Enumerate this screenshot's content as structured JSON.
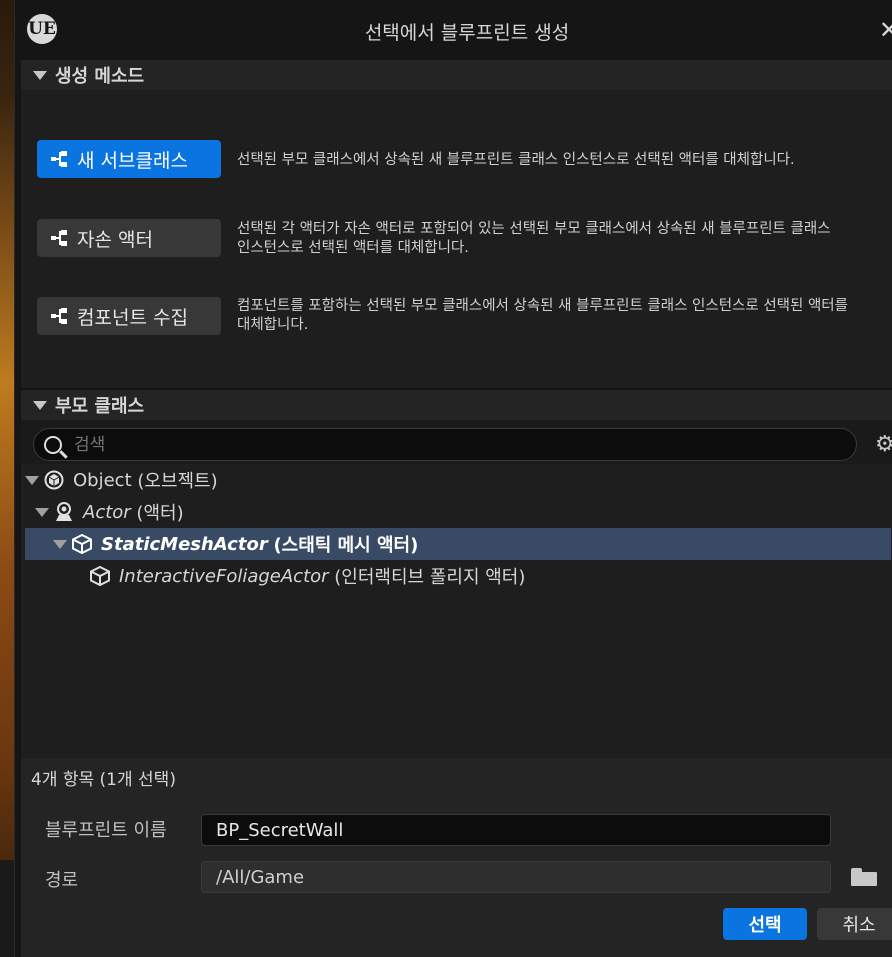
{
  "window": {
    "title": "선택에서 블루프린트 생성",
    "logo": "UE"
  },
  "creation_method": {
    "header": "생성 메소드",
    "options": [
      {
        "label": "새 서브클래스",
        "description": "선택된 부모 클래스에서 상속된 새 블루프린트 클래스 인스턴스로 선택된 액터를 대체합니다.",
        "description2": "",
        "active": true
      },
      {
        "label": "자손 액터",
        "description": "선택된 각 액터가 자손 액터로 포함되어 있는 선택된 부모 클래스에서 상속된 새 블루프린트 클래스",
        "description2": "인스턴스로 선택된 액터를 대체합니다.",
        "active": false
      },
      {
        "label": "컴포넌트 수집",
        "description": "컴포넌트를 포함하는 선택된 부모 클래스에서 상속된 새 블루프린트 클래스 인스턴스로 선택된 액터를",
        "description2": "대체합니다.",
        "active": false
      }
    ]
  },
  "parent_class": {
    "header": "부모 클래스",
    "search_placeholder": "검색",
    "tree": [
      {
        "name": "Object",
        "paren": "(오브젝트)"
      },
      {
        "name": "Actor",
        "paren": "(액터)"
      },
      {
        "name": "StaticMeshActor",
        "paren": "(스태틱 메시 액터)"
      },
      {
        "name": "InteractiveFoliageActor",
        "paren": "(인터랙티브 폴리지 액터)"
      }
    ],
    "count": "4개 항목 (1개 선택)"
  },
  "form": {
    "name_label": "블루프린트 이름",
    "name_value": "BP_SecretWall",
    "path_label": "경로",
    "path_value": "/All/Game"
  },
  "buttons": {
    "select": "선택",
    "cancel": "취소"
  },
  "colors": {
    "accent": "#0a74e0",
    "selected_row": "#384a64"
  }
}
